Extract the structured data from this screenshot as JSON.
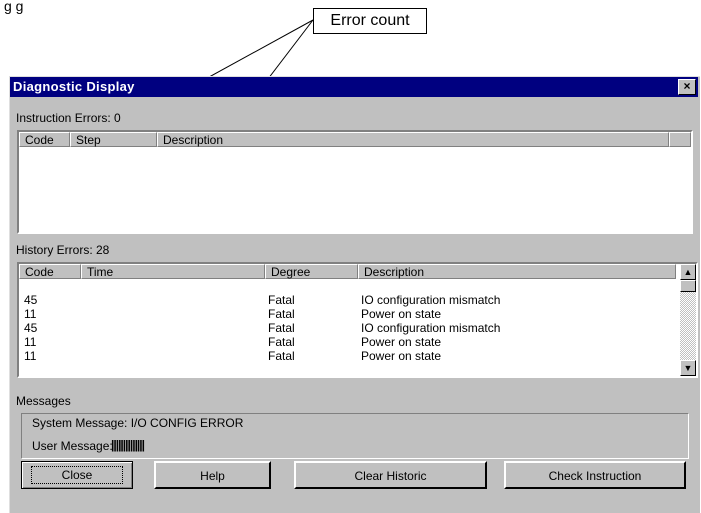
{
  "caption_top": "g  g",
  "callout": {
    "label": "Error count"
  },
  "window": {
    "title": "Diagnostic Display",
    "close_glyph": "×"
  },
  "instruction": {
    "label": "Instruction Errors: 0",
    "columns": [
      "Code",
      "Step",
      "Description"
    ],
    "rows": []
  },
  "history": {
    "label": "History Errors: 28",
    "columns": [
      "Code",
      "Time",
      "Degree",
      "Description"
    ],
    "rows": [
      {
        "code": "45",
        "time": "",
        "degree": "Fatal",
        "description": "IO configuration mismatch"
      },
      {
        "code": "11",
        "time": "",
        "degree": "Fatal",
        "description": "Power on state"
      },
      {
        "code": "45",
        "time": "",
        "degree": "Fatal",
        "description": "IO configuration mismatch"
      },
      {
        "code": "11",
        "time": "",
        "degree": "Fatal",
        "description": "Power on state"
      },
      {
        "code": "11",
        "time": "",
        "degree": "Fatal",
        "description": "Power on state"
      }
    ]
  },
  "messages": {
    "label": "Messages",
    "system_message": "System Message: I/O CONFIG ERROR",
    "user_message_label": "User Message:",
    "user_message_value": "||||||||||||||"
  },
  "buttons": {
    "close": "Close",
    "help": "Help",
    "clear_historic": "Clear Historic",
    "check_instruction": "Check Instruction"
  },
  "icons": {
    "scroll_up": "▲",
    "scroll_down": "▼"
  }
}
